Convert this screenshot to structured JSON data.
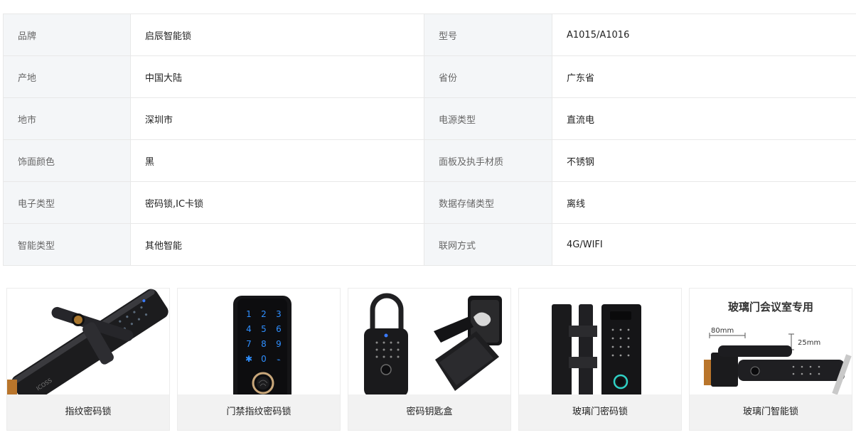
{
  "specs": [
    {
      "k1": "品牌",
      "v1": "启辰智能锁",
      "k2": "型号",
      "v2": "A1015/A1016"
    },
    {
      "k1": "产地",
      "v1": "中国大陆",
      "k2": "省份",
      "v2": "广东省"
    },
    {
      "k1": "地市",
      "v1": "深圳市",
      "k2": "电源类型",
      "v2": "直流电"
    },
    {
      "k1": "饰面颜色",
      "v1": "黑",
      "k2": "面板及执手材质",
      "v2": "不锈钢"
    },
    {
      "k1": "电子类型",
      "v1": "密码锁,IC卡锁",
      "k2": "数据存储类型",
      "v2": "离线"
    },
    {
      "k1": "智能类型",
      "v1": "其他智能",
      "k2": "联网方式",
      "v2": "4G/WIFI"
    }
  ],
  "products": [
    {
      "title": "指纹密码锁",
      "image": "fingerprint-handle-lock-image"
    },
    {
      "title": "门禁指纹密码锁",
      "image": "access-keypad-lock-image",
      "keys": [
        "1",
        "2",
        "3",
        "4",
        "5",
        "6",
        "7",
        "8",
        "9",
        "✱",
        "0",
        "⌁"
      ]
    },
    {
      "title": "密码钥匙盒",
      "image": "key-lock-box-image"
    },
    {
      "title": "玻璃门密码锁",
      "image": "glass-door-lock-image"
    },
    {
      "title": "玻璃门智能锁",
      "image": "glass-door-smart-lock-image",
      "banner": "玻璃门会议室专用",
      "dims": [
        "80mm",
        "25mm"
      ]
    }
  ]
}
